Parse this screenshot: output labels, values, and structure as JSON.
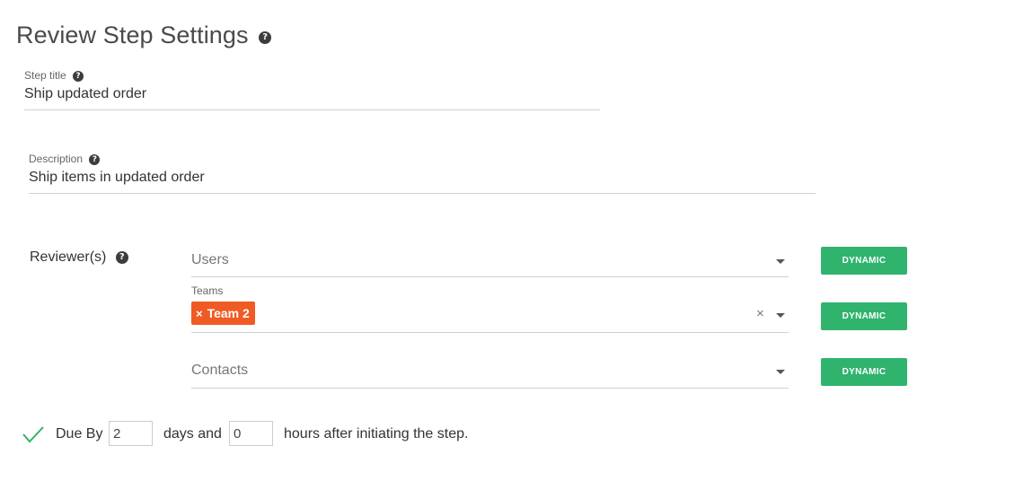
{
  "title": "Review Step Settings",
  "step_title": {
    "label": "Step title",
    "value": "Ship updated order"
  },
  "description": {
    "label": "Description",
    "value": "Ship items in updated order"
  },
  "reviewers": {
    "label": "Reviewer(s)",
    "users": {
      "placeholder": "Users",
      "button": "DYNAMIC"
    },
    "teams": {
      "label": "Teams",
      "chips": [
        "Team 2"
      ],
      "button": "DYNAMIC"
    },
    "contacts": {
      "placeholder": "Contacts",
      "button": "DYNAMIC"
    }
  },
  "due": {
    "label": "Due By",
    "days_value": "2",
    "days_text": "days and",
    "hours_value": "0",
    "hours_text": "hours after initiating the step."
  },
  "icons": {
    "help": "question-circle-icon",
    "check": "check-icon",
    "caret": "chevron-down-icon",
    "remove": "close-icon"
  },
  "colors": {
    "accent_green": "#2fb36d",
    "chip_orange": "#f05a24",
    "check_green": "#2fb36d"
  }
}
